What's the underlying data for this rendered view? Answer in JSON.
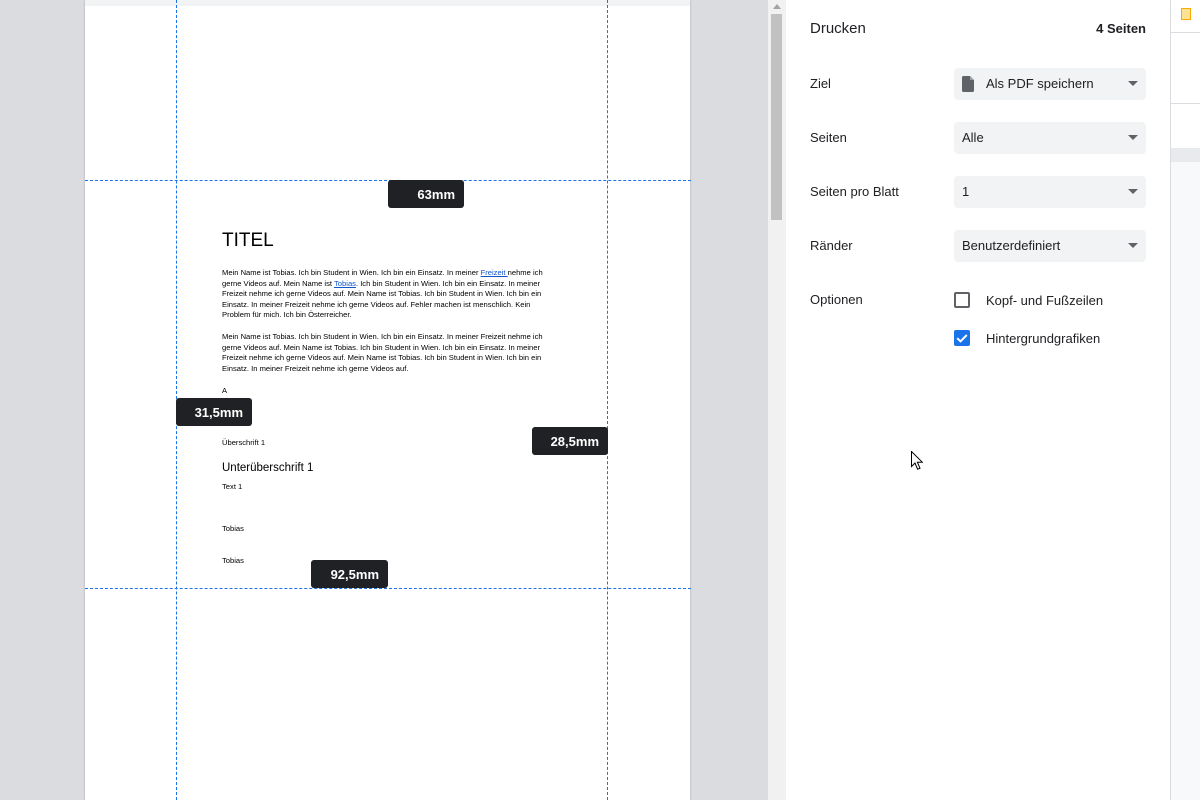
{
  "preview": {
    "margins": {
      "top": "63mm",
      "left": "31,5mm",
      "right": "28,5mm",
      "bottom": "92,5mm"
    },
    "document": {
      "title": "TITEL",
      "paragraph1": {
        "before_link1": "Mein Name ist Tobias. Ich bin Student in Wien. Ich bin ein Einsatz. In meiner ",
        "link1": "Freizeit ",
        "between_links": "nehme ich gerne Videos auf. Mein Name ist ",
        "link2": "Tobias",
        "after_link2": ". Ich bin Student in Wien. Ich bin ein Einsatz. In meiner Freizeit nehme ich gerne Videos auf. Mein Name ist Tobias. Ich bin Student in Wien. Ich bin ein Einsatz. In meiner Freizeit nehme ich gerne Videos auf. Fehler machen ist menschlich. Kein Problem für mich. Ich bin Österreicher."
      },
      "paragraph2": "Mein Name ist Tobias. Ich bin Student in Wien. Ich bin ein Einsatz. In meiner Freizeit nehme ich gerne Videos auf. Mein Name ist Tobias. Ich bin Student in Wien. Ich bin ein Einsatz. In meiner Freizeit nehme ich gerne Videos auf. Mein Name ist Tobias. Ich bin Student in Wien. Ich bin ein Einsatz. In meiner Freizeit nehme ich gerne Videos auf.",
      "letter": "A",
      "heading1": "Überschrift 1",
      "subheading": "Unterüberschrift 1",
      "text1": "Text 1",
      "name1": "Tobias",
      "name2": "Tobias"
    }
  },
  "panel": {
    "title": "Drucken",
    "page_count": "4 Seiten",
    "destination": {
      "label": "Ziel",
      "value": "Als PDF speichern",
      "icon": "document-icon"
    },
    "pages": {
      "label": "Seiten",
      "value": "Alle"
    },
    "pages_per_sheet": {
      "label": "Seiten pro Blatt",
      "value": "1"
    },
    "margins": {
      "label": "Ränder",
      "value": "Benutzerdefiniert"
    },
    "options": {
      "label": "Optionen",
      "headers_footers": {
        "label": "Kopf- und Fußzeilen",
        "checked": false
      },
      "background_graphics": {
        "label": "Hintergrundgrafiken",
        "checked": true
      }
    }
  },
  "colors": {
    "accent": "#1a73e8",
    "margin_label_bg": "#202124",
    "link": "#1155cc"
  }
}
